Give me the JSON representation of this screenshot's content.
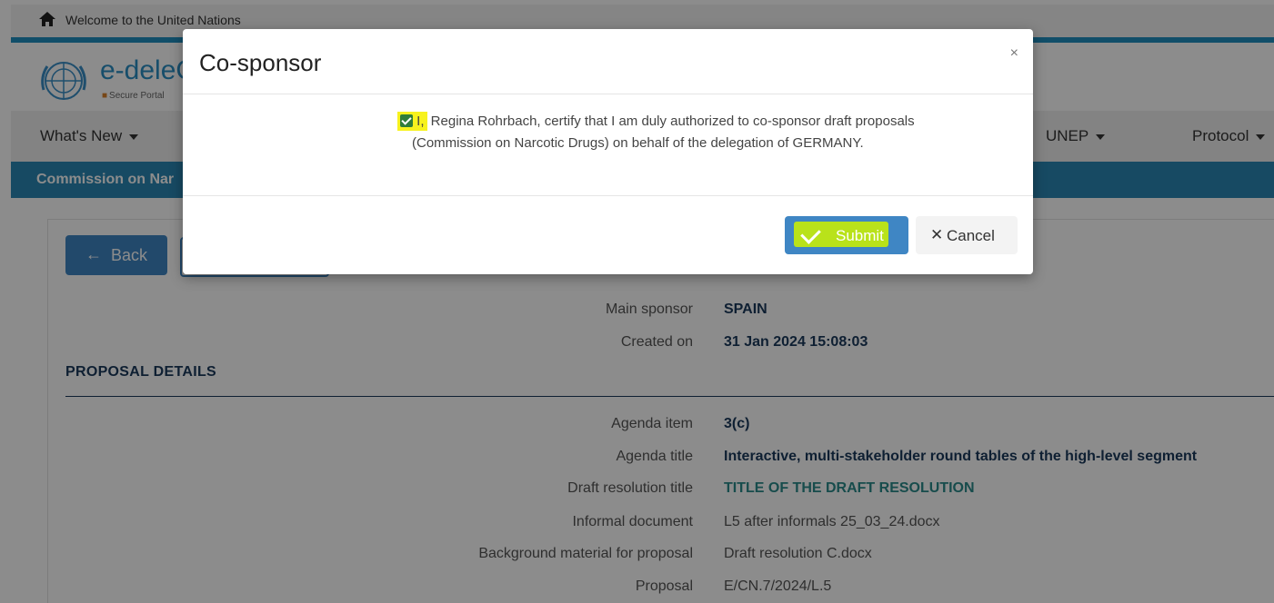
{
  "topbar": {
    "welcome_text": "Welcome to the United Nations"
  },
  "header": {
    "brand": "e-deleG",
    "secure_text": "Secure Portal"
  },
  "nav": {
    "whats_new": "What's New",
    "unep": "UNEP",
    "protocol": "Protocol"
  },
  "subbar": {
    "title": "Commission on Nar"
  },
  "actions": {
    "back_label": "Back"
  },
  "details": {
    "main_sponsor_label": "Main sponsor",
    "main_sponsor_value": "SPAIN",
    "created_on_label": "Created on",
    "created_on_value": "31 Jan 2024 15:08:03",
    "section_title": "PROPOSAL DETAILS",
    "agenda_item_label": "Agenda item",
    "agenda_item_value": "3(c)",
    "agenda_title_label": "Agenda title",
    "agenda_title_value": "Interactive, multi-stakeholder round tables of the high-level segment",
    "draft_title_label": "Draft resolution title",
    "draft_title_value": "TITLE OF THE DRAFT RESOLUTION",
    "informal_doc_label": "Informal document",
    "informal_doc_value": "L5 after informals 25_03_24.docx",
    "background_label": "Background material for proposal",
    "background_value": "Draft resolution C.docx",
    "proposal_label": "Proposal",
    "proposal_value": "E/CN.7/2024/L.5"
  },
  "modal": {
    "title": "Co-sponsor",
    "close_glyph": "×",
    "cert_prefix": "I,",
    "cert_line1": " Regina Rohrbach,  certify that I am duly authorized to co-sponsor draft proposals",
    "cert_line2": "(Commission on Narcotic Drugs) on behalf of the delegation of  GERMANY.",
    "checkbox_checked": true,
    "submit_label": "Submit",
    "cancel_label": "Cancel"
  },
  "colors": {
    "accent": "#3f86c4",
    "highlight": "#f7f21e",
    "submit_highlight": "#b9e21a",
    "section": "#1b3a5c",
    "teal": "#2a8a8a"
  },
  "icons": {
    "home": "home-icon",
    "logo": "un-logo-icon",
    "back": "arrow-left-icon",
    "close": "close-icon",
    "check": "check-icon",
    "cancel": "x-icon"
  }
}
